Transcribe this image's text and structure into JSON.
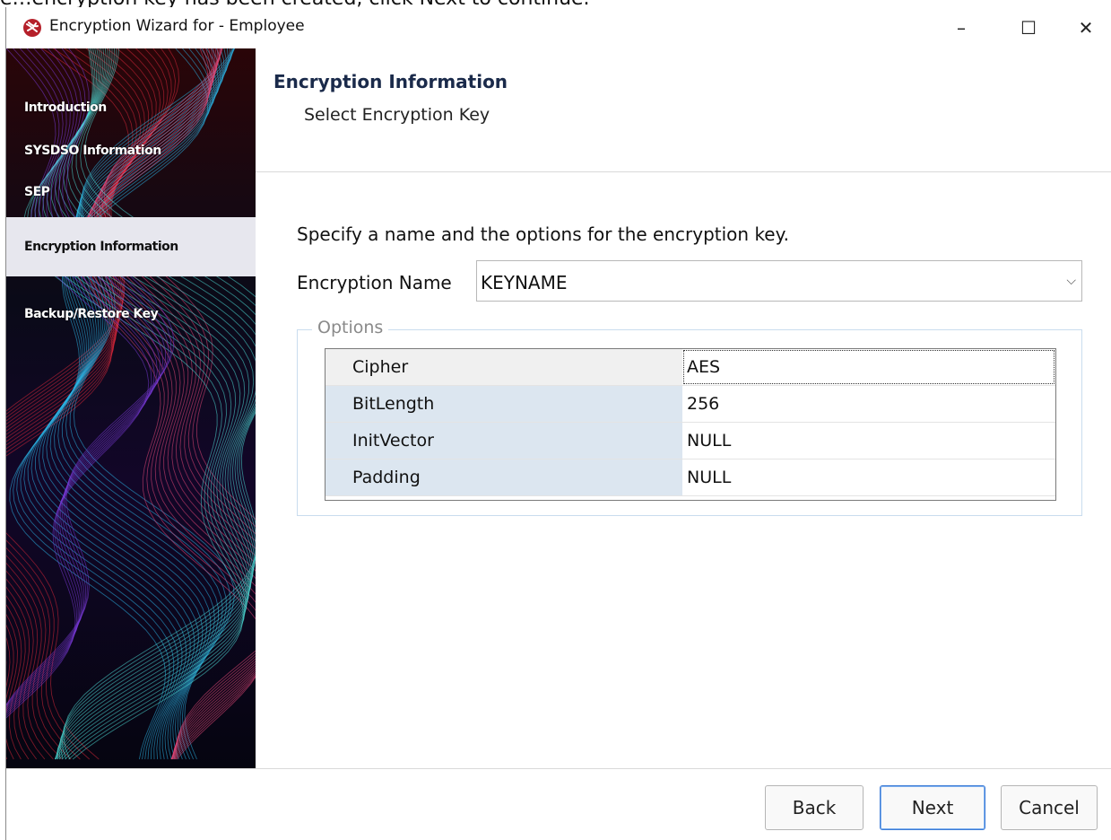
{
  "window": {
    "title": "Encryption Wizard for - Employee",
    "icon": "app-logo-icon",
    "controls": {
      "minimize": "–",
      "maximize": "☐",
      "close": "✕"
    }
  },
  "top_strip_text": "e…encryption key has been created, click Next to continue.",
  "sidebar": {
    "items": [
      {
        "label": "Introduction",
        "active": false
      },
      {
        "label": "SYSDSO Information",
        "active": false
      },
      {
        "label": "SEP",
        "active": false
      },
      {
        "label": "Encryption Information",
        "active": true
      },
      {
        "label": "Backup/Restore Key",
        "active": false
      }
    ]
  },
  "header": {
    "title": "Encryption Information",
    "subtitle": "Select Encryption Key"
  },
  "content": {
    "instruction": "Specify a name and the options for the encryption key.",
    "encryption_name_label": "Encryption Name",
    "encryption_name_value": "KEYNAME",
    "options_legend": "Options",
    "options": [
      {
        "name": "Cipher",
        "value": "AES"
      },
      {
        "name": "BitLength",
        "value": "256"
      },
      {
        "name": "InitVector",
        "value": "NULL"
      },
      {
        "name": "Padding",
        "value": "NULL"
      }
    ]
  },
  "footer": {
    "back": "Back",
    "next": "Next",
    "cancel": "Cancel"
  },
  "colors": {
    "accent": "#3d7bd6",
    "grid_name_bg": "#dce6f0",
    "group_border": "#c9dcee"
  }
}
